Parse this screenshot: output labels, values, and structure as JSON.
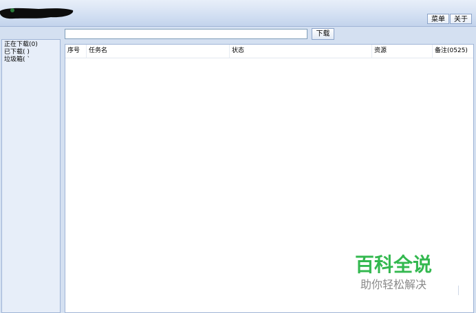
{
  "header": {
    "menu_label": "菜单",
    "about_label": "关于"
  },
  "toolbar": {
    "url_value": "",
    "download_label": "下载"
  },
  "sidebar": {
    "items": [
      {
        "label": "正在下载(0)"
      },
      {
        "label": "已下载(  )"
      },
      {
        "label": "垃圾箱(  `"
      }
    ]
  },
  "table": {
    "columns": [
      "序号",
      "任务名",
      "状态",
      "资源",
      "备注(0525)"
    ]
  },
  "watermark": {
    "title": "百科全说",
    "subtitle": "助你轻松解决"
  },
  "colors": {
    "watermark_green": "#33b84f",
    "chrome_blue": "#d4e0f1"
  }
}
